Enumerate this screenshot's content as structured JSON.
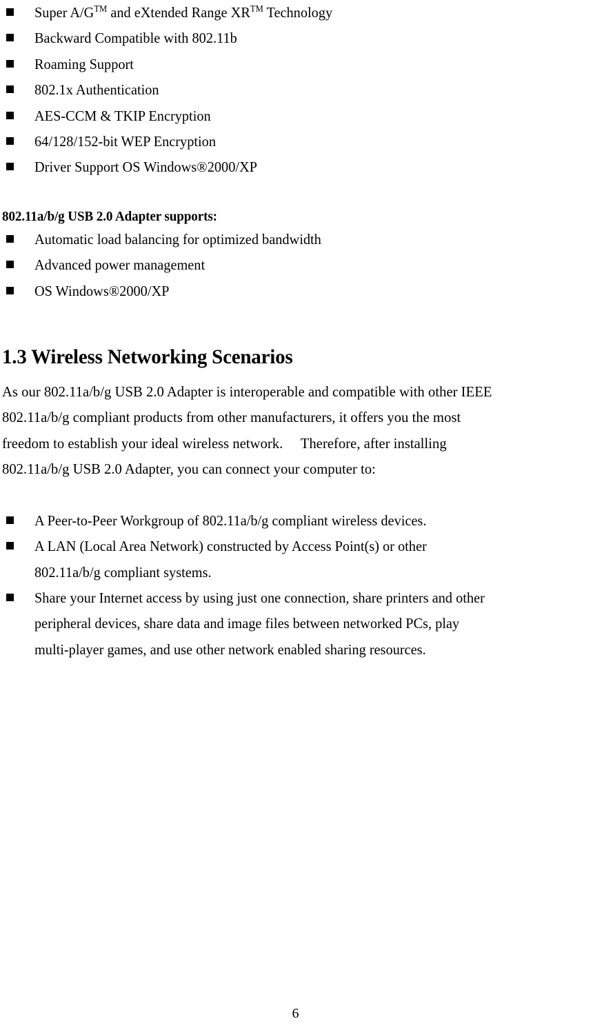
{
  "document": {
    "page_number": "6",
    "features_list": [
      {
        "id": "super-ag-xr",
        "segments": [
          {
            "text": "Super A/G"
          },
          {
            "text": "TM",
            "sup": true
          },
          {
            "text": " and eXtended Range XR"
          },
          {
            "text": "TM",
            "sup": true
          },
          {
            "text": " Technology"
          }
        ],
        "plain": "Super A/GTM and eXtended Range XRTM Technology"
      },
      {
        "id": "backward-compatible",
        "segments": [
          {
            "text": "Backward Compatible with 802.11b"
          }
        ],
        "plain": "Backward Compatible with 802.11b"
      },
      {
        "id": "roaming-support",
        "segments": [
          {
            "text": "Roaming Support"
          }
        ],
        "plain": "Roaming Support"
      },
      {
        "id": "8021x-authentication",
        "segments": [
          {
            "text": "802.1x Authentication"
          }
        ],
        "plain": "802.1x Authentication"
      },
      {
        "id": "aes-ccm-tkip",
        "segments": [
          {
            "text": "AES-CCM & TKIP Encryption"
          }
        ],
        "plain": "AES-CCM & TKIP Encryption"
      },
      {
        "id": "wep-encryption",
        "segments": [
          {
            "text": "64/128/152-bit WEP Encryption"
          }
        ],
        "plain": "64/128/152-bit WEP Encryption"
      },
      {
        "id": "driver-support-os",
        "segments": [
          {
            "text": "Driver Support OS Windows®2000/XP"
          }
        ],
        "plain": "Driver Support OS Windows®2000/XP"
      }
    ],
    "supports_heading": "802.11a/b/g USB 2.0 Adapter supports:",
    "supports_list": [
      {
        "id": "automatic-load-balancing",
        "segments": [
          {
            "text": "Automatic load balancing for optimized bandwidth"
          }
        ],
        "plain": "Automatic load balancing for optimized bandwidth"
      },
      {
        "id": "advanced-power-management",
        "segments": [
          {
            "text": "Advanced power management"
          }
        ],
        "plain": "Advanced power management"
      },
      {
        "id": "os-windows",
        "segments": [
          {
            "text": "OS Windows®2000/XP"
          }
        ],
        "plain": "OS Windows®2000/XP"
      }
    ],
    "section": {
      "number": "1.3",
      "title": "Wireless Networking Scenarios",
      "heading_full": "1.3 Wireless Networking Scenarios",
      "paragraph_lines": [
        "As our 802.11a/b/g USB 2.0 Adapter is interoperable and compatible with other IEEE",
        "802.11a/b/g compliant products from other manufacturers, it offers you the most",
        "freedom to establish your ideal wireless network.  Therefore, after installing",
        "802.11a/b/g USB 2.0 Adapter, you can connect your computer to:"
      ]
    },
    "scenarios_list": [
      {
        "id": "peer-to-peer-workgroup",
        "lines": [
          "A Peer-to-Peer Workgroup of 802.11a/b/g compliant wireless devices."
        ],
        "plain": "A Peer-to-Peer Workgroup of 802.11a/b/g compliant wireless devices."
      },
      {
        "id": "lan-access-point",
        "lines": [
          "A LAN (Local Area Network) constructed by Access Point(s) or other",
          "802.11a/b/g compliant systems."
        ],
        "plain": "A LAN (Local Area Network) constructed by Access Point(s) or other 802.11a/b/g compliant systems."
      },
      {
        "id": "share-internet-access",
        "lines": [
          "Share your Internet access by using just one connection, share printers and other",
          "peripheral devices, share data and image files between networked PCs, play",
          "multi-player games, and use other network enabled sharing resources."
        ],
        "plain": "Share your Internet access by using just one connection, share printers and other peripheral devices, share data and image files between networked PCs, play multi-player games, and use other network enabled sharing resources."
      }
    ]
  }
}
